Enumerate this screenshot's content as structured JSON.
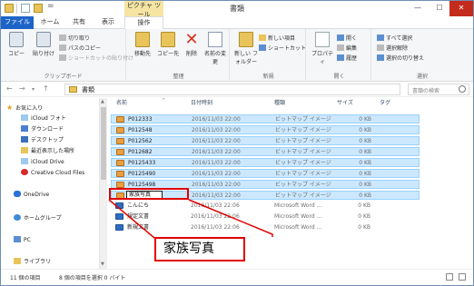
{
  "window": {
    "title": "書類",
    "contextual_tab_group": "ピクチャ ツール"
  },
  "ribbon_tabs": {
    "file": "ファイル",
    "home": "ホーム",
    "share": "共有",
    "view": "表示",
    "manage": "操作"
  },
  "ribbon": {
    "clipboard": {
      "copy": "コピー",
      "paste": "貼り付け",
      "cut": "切り取り",
      "copy_path": "パスのコピー",
      "paste_shortcut": "ショートカットの貼り付け",
      "label": "クリップボード"
    },
    "organize": {
      "move_to": "移動先",
      "copy_to": "コピー先",
      "delete": "削除",
      "rename": "名前の変更",
      "label": "整理"
    },
    "new": {
      "new_folder": "新しい フォルダー",
      "new_item": "新しい項目",
      "easy_access": "ショートカット",
      "label": "新規"
    },
    "open": {
      "properties": "プロパティ",
      "open": "開く",
      "edit": "編集",
      "history": "履歴",
      "label": "開く"
    },
    "select": {
      "select_all": "すべて選択",
      "select_none": "選択解除",
      "invert": "選択の切り替え",
      "label": "選択"
    }
  },
  "address": {
    "path": "書類",
    "search_placeholder": "書類の検索"
  },
  "nav_pane": {
    "items": [
      {
        "label": "お気に入り",
        "icon": "star-icon"
      },
      {
        "label": "iCloud フォト",
        "icon": "cloud-icon"
      },
      {
        "label": "ダウンロード",
        "icon": "download-icon"
      },
      {
        "label": "デスクトップ",
        "icon": "desktop-icon"
      },
      {
        "label": "最近表示した場所",
        "icon": "recent-icon"
      },
      {
        "label": "iCloud Drive",
        "icon": "cloud-icon"
      },
      {
        "label": "Creative Cloud Files",
        "icon": "creative-cloud-icon"
      },
      {
        "label": "OneDrive",
        "icon": "onedrive-icon"
      },
      {
        "label": "ホームグループ",
        "icon": "homegroup-icon"
      },
      {
        "label": "PC",
        "icon": "pc-icon"
      },
      {
        "label": "ライブラリ",
        "icon": "library-icon"
      }
    ]
  },
  "columns": {
    "name": "名前",
    "date": "日付時刻",
    "type": "種類",
    "size": "サイズ",
    "tags": "タグ"
  },
  "files": [
    {
      "name": "P012333",
      "date": "2016/11/03 22:00",
      "type": "ビットマップ イメージ",
      "size": "0 KB",
      "kind": "image",
      "selected": true
    },
    {
      "name": "P012548",
      "date": "2016/11/03 22:00",
      "type": "ビットマップ イメージ",
      "size": "0 KB",
      "kind": "image",
      "selected": true
    },
    {
      "name": "P012562",
      "date": "2016/11/03 22:00",
      "type": "ビットマップ イメージ",
      "size": "0 KB",
      "kind": "image",
      "selected": true
    },
    {
      "name": "P012682",
      "date": "2016/11/03 22:00",
      "type": "ビットマップ イメージ",
      "size": "0 KB",
      "kind": "image",
      "selected": true
    },
    {
      "name": "P0125433",
      "date": "2016/11/03 22:00",
      "type": "ビットマップ イメージ",
      "size": "0 KB",
      "kind": "image",
      "selected": true
    },
    {
      "name": "P0125490",
      "date": "2016/11/03 22:00",
      "type": "ビットマップ イメージ",
      "size": "0 KB",
      "kind": "image",
      "selected": true
    },
    {
      "name": "P0125498",
      "date": "2016/11/03 22:00",
      "type": "ビットマップ イメージ",
      "size": "0 KB",
      "kind": "image",
      "selected": true
    },
    {
      "name": "家族写真",
      "date": "2016/11/03 22:00",
      "type": "ビットマップ イメージ",
      "size": "0 KB",
      "kind": "image",
      "selected": true,
      "renaming": true
    },
    {
      "name": "こんにち",
      "date": "2016/11/03 22:06",
      "type": "Microsoft Word ...",
      "size": "0 KB",
      "kind": "doc",
      "selected": false
    },
    {
      "name": "規定文書",
      "date": "2016/11/03 22:06",
      "type": "Microsoft Word ...",
      "size": "0 KB",
      "kind": "doc",
      "selected": false
    },
    {
      "name": "新規文書",
      "date": "2016/11/03 22:06",
      "type": "Microsoft Word ...",
      "size": "0 KB",
      "kind": "doc",
      "selected": false
    }
  ],
  "status": {
    "count": "11 個の項目",
    "selection": "8 個の項目を選択 0 バイト"
  },
  "annotation": {
    "callout_text": "家族写真",
    "color": "#e00000"
  }
}
